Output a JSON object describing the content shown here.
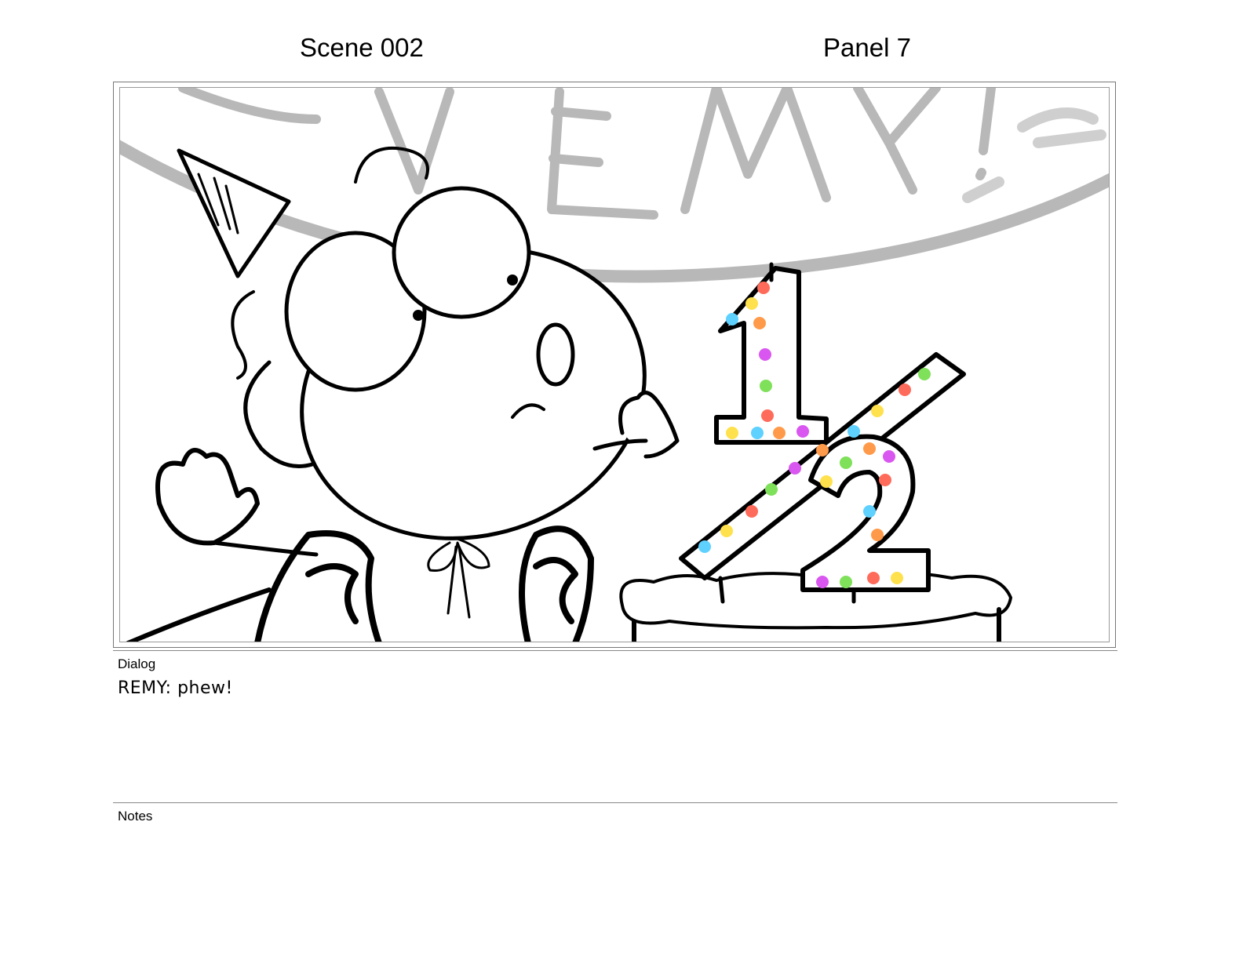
{
  "header": {
    "scene": "Scene 002",
    "panel": "Panel 7"
  },
  "panel_artwork": {
    "banner_lettering": "REMY!",
    "candle_numerator": "1",
    "candle_denominator": "2",
    "dot_colors": [
      "#ff6b5a",
      "#ffe14d",
      "#5ed1ff",
      "#ff9a4a",
      "#d957f0",
      "#7fe05a"
    ]
  },
  "dialog": {
    "label": "Dialog",
    "text": "REMY:  phew!"
  },
  "notes": {
    "label": "Notes",
    "text": ""
  }
}
